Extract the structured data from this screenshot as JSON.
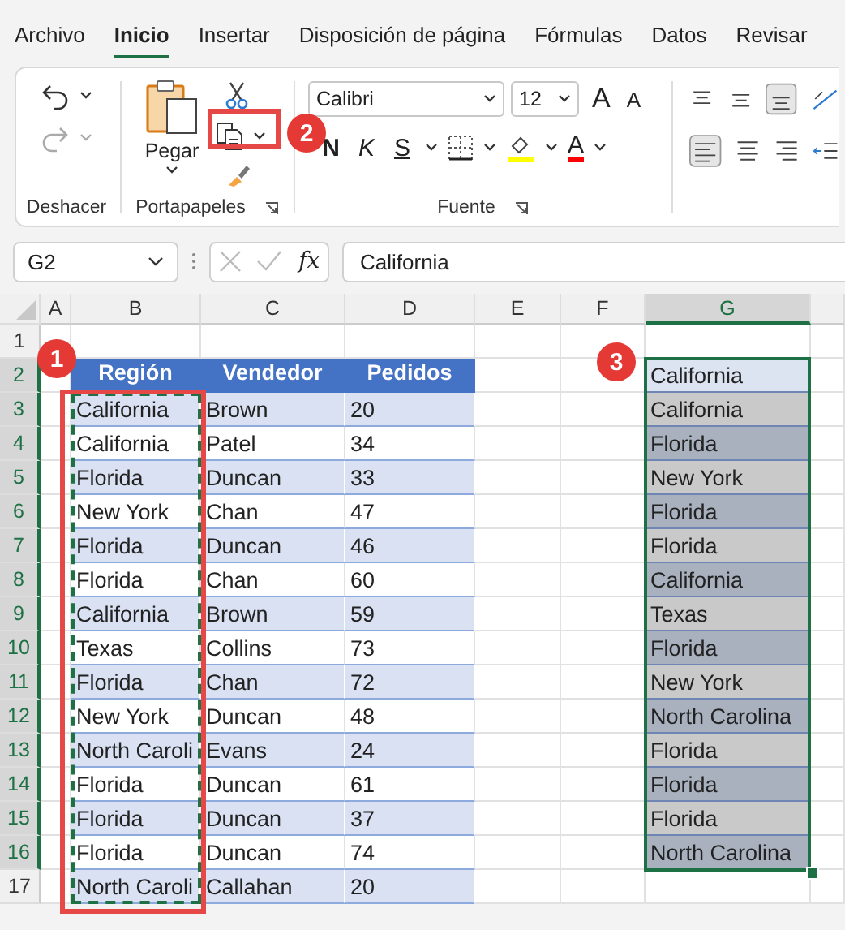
{
  "menu_tabs": [
    {
      "label": "Archivo",
      "selected": false
    },
    {
      "label": "Inicio",
      "selected": true
    },
    {
      "label": "Insertar",
      "selected": false
    },
    {
      "label": "Disposición de página",
      "selected": false
    },
    {
      "label": "Fórmulas",
      "selected": false
    },
    {
      "label": "Datos",
      "selected": false
    },
    {
      "label": "Revisar",
      "selected": false
    }
  ],
  "ribbon": {
    "group_labels": [
      "Deshacer",
      "Portapapeles",
      "Fuente"
    ],
    "paste_label": "Pegar",
    "font_name": "Calibri",
    "font_size": "12",
    "grow_font": "A",
    "shrink_font": "A",
    "bold": "N",
    "italic": "K",
    "underline": "S",
    "font_color": "A"
  },
  "callouts": [
    "1",
    "2",
    "3"
  ],
  "formula_bar": {
    "name_box": "G2",
    "fx": "fx",
    "value": "California"
  },
  "sheet": {
    "columns": [
      {
        "label": "A",
        "selected": false
      },
      {
        "label": "B",
        "selected": false
      },
      {
        "label": "C",
        "selected": false
      },
      {
        "label": "D",
        "selected": false
      },
      {
        "label": "E",
        "selected": false
      },
      {
        "label": "F",
        "selected": false
      },
      {
        "label": "G",
        "selected": true
      }
    ],
    "row_headers": [
      {
        "label": "1",
        "selected": false
      },
      {
        "label": "2",
        "selected": true
      },
      {
        "label": "3",
        "selected": true
      },
      {
        "label": "4",
        "selected": true
      },
      {
        "label": "5",
        "selected": true
      },
      {
        "label": "6",
        "selected": true
      },
      {
        "label": "7",
        "selected": true
      },
      {
        "label": "8",
        "selected": true
      },
      {
        "label": "9",
        "selected": true
      },
      {
        "label": "10",
        "selected": true
      },
      {
        "label": "11",
        "selected": true
      },
      {
        "label": "12",
        "selected": true
      },
      {
        "label": "13",
        "selected": true
      },
      {
        "label": "14",
        "selected": true
      },
      {
        "label": "15",
        "selected": true
      },
      {
        "label": "16",
        "selected": true
      },
      {
        "label": "17",
        "selected": false
      }
    ],
    "table": {
      "headers": [
        "Región",
        "Vendedor",
        "Pedidos"
      ],
      "rows": [
        [
          "California",
          "Brown",
          "20"
        ],
        [
          "California",
          "Patel",
          "34"
        ],
        [
          "Florida",
          "Duncan",
          "33"
        ],
        [
          "New York",
          "Chan",
          "47"
        ],
        [
          "Florida",
          "Duncan",
          "46"
        ],
        [
          "Florida",
          "Chan",
          "60"
        ],
        [
          "California",
          "Brown",
          "59"
        ],
        [
          "Texas",
          "Collins",
          "73"
        ],
        [
          "Florida",
          "Chan",
          "72"
        ],
        [
          "New York",
          "Duncan",
          "48"
        ],
        [
          "North Caroli",
          "Evans",
          "24"
        ],
        [
          "Florida",
          "Duncan",
          "61"
        ],
        [
          "Florida",
          "Duncan",
          "37"
        ],
        [
          "Florida",
          "Duncan",
          "74"
        ],
        [
          "North Caroli",
          "Callahan",
          "20"
        ]
      ]
    },
    "pasted": [
      "California",
      "California",
      "Florida",
      "New York",
      "Florida",
      "Florida",
      "California",
      "Texas",
      "Florida",
      "New York",
      "North Carolina",
      "Florida",
      "Florida",
      "Florida",
      "North Carolina"
    ]
  }
}
